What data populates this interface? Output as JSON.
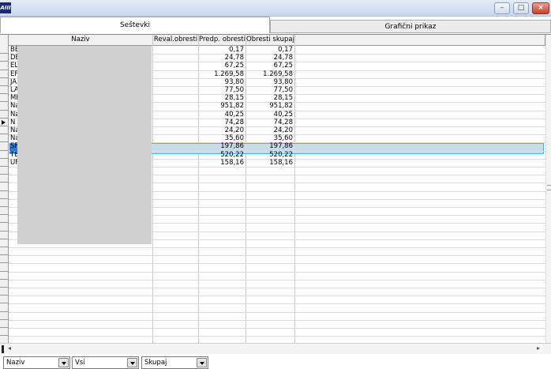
{
  "window": {
    "icon_text": "AIII",
    "controls": {
      "minimize": "–",
      "maximize": "□",
      "close": "×"
    }
  },
  "tabs": [
    {
      "label": "Seštevki",
      "active": true
    },
    {
      "label": "Grafični prikaz",
      "active": false
    }
  ],
  "grid": {
    "columns": [
      "Naziv",
      "Reval.obresti",
      "Predp. obresti",
      "Obresti skupaj"
    ],
    "rows": [
      {
        "naziv": "BE",
        "reval": "",
        "predp": "0,17",
        "skupaj": "0,17"
      },
      {
        "naziv": "DE",
        "reval": "",
        "predp": "24,78",
        "skupaj": "24,78"
      },
      {
        "naziv": "EL",
        "reval": "",
        "predp": "67,25",
        "skupaj": "67,25"
      },
      {
        "naziv": "EF",
        "reval": "",
        "predp": "1.269,58",
        "skupaj": "1.269,58"
      },
      {
        "naziv": "JA",
        "reval": "",
        "predp": "93,80",
        "skupaj": "93,80"
      },
      {
        "naziv": "LA",
        "reval": "",
        "predp": "77,50",
        "skupaj": "77,50"
      },
      {
        "naziv": "ME",
        "reval": "",
        "predp": "28,15",
        "skupaj": "28,15"
      },
      {
        "naziv": "Na",
        "reval": "",
        "predp": "951,82",
        "skupaj": "951,82"
      },
      {
        "naziv": "Na",
        "reval": "",
        "predp": "40,25",
        "skupaj": "40,25"
      },
      {
        "naziv": "N",
        "reval": "",
        "predp": "74,28",
        "skupaj": "74,28"
      },
      {
        "naziv": "Na",
        "reval": "",
        "predp": "24,20",
        "skupaj": "24,20"
      },
      {
        "naziv": "Na",
        "reval": "",
        "predp": "35,60",
        "skupaj": "35,60"
      },
      {
        "naziv": "SF",
        "reval": "",
        "predp": "197,86",
        "skupaj": "197,86"
      },
      {
        "naziv": "TE",
        "reval": "",
        "predp": "520,22",
        "skupaj": "520,22"
      },
      {
        "naziv": "UF",
        "reval": "",
        "predp": "158,16",
        "skupaj": "158,16"
      }
    ],
    "selected_row_index": 9
  },
  "scrollbar": {
    "left_arrow": "◂",
    "right_arrow": "▸"
  },
  "filters": [
    {
      "value": "Naziv"
    },
    {
      "value": "Vsi"
    },
    {
      "value": "Skupaj"
    }
  ]
}
